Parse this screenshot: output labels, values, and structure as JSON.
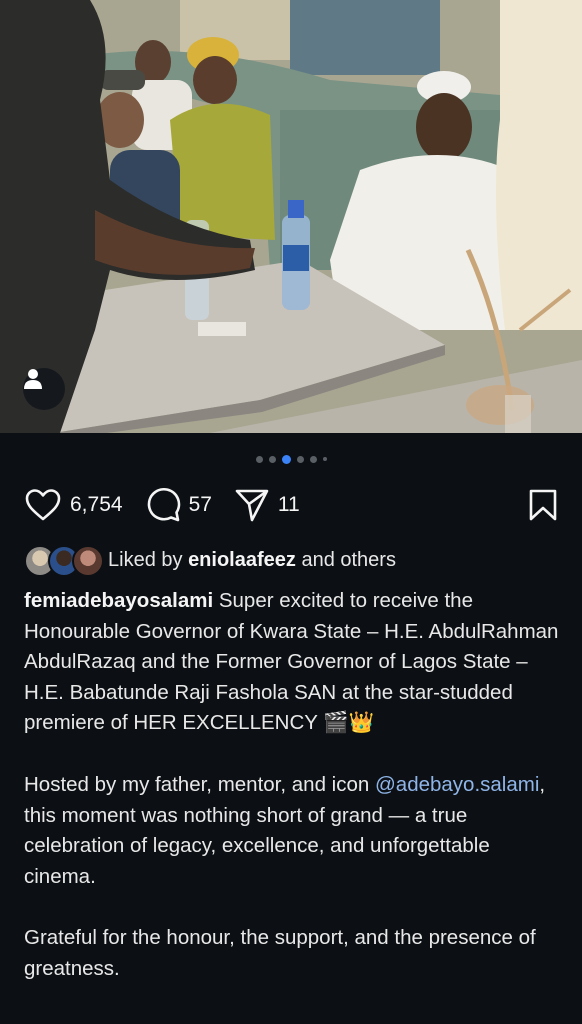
{
  "post": {
    "carousel": {
      "total_dots": 6,
      "active_index": 2
    },
    "actions": {
      "likes": "6,754",
      "comments": "57",
      "shares": "11"
    },
    "liked_by": {
      "prefix": "Liked by",
      "user": "eniolaafeez",
      "suffix": "and others"
    },
    "caption": {
      "username": "femiadebayosalami",
      "paragraph1": "Super excited to receive the Honourable Governor of Kwara State – H.E. AbdulRahman AbdulRazaq and the Former Governor of Lagos State – H.E. Babatunde Raji Fashola SAN at the star-studded premiere of HER EXCELLENCY 🎬👑",
      "paragraph2_pre": "Hosted by my father, mentor, and icon",
      "mention": "@adebayo.salami",
      "paragraph2_post": ", this moment was nothing short of grand — a true celebration of legacy, excellence, and unforgettable cinema.",
      "paragraph3": "Grateful for the honour, the support, and the presence of greatness."
    },
    "icons": {
      "like": "heart-icon",
      "comment": "comment-icon",
      "share": "send-icon",
      "save": "bookmark-icon",
      "tags": "user-tag-icon"
    },
    "colors": {
      "background": "#0c1014",
      "active_dot": "#3b82f6",
      "mention": "#8fb4e8"
    }
  }
}
